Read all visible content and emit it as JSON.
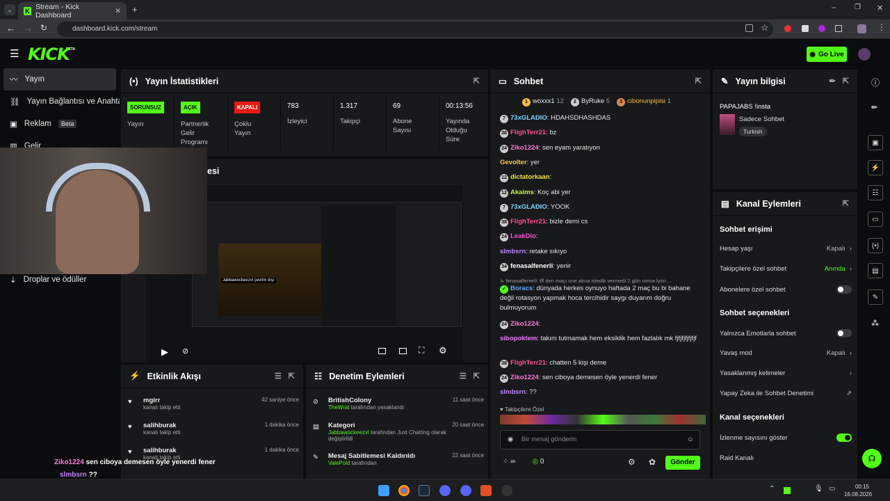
{
  "browser": {
    "tab_title": "Stream - Kick Dashboard",
    "url": "dashboard.kick.com/stream"
  },
  "header": {
    "logo": "KICK",
    "beta": "BETA",
    "go_live": "Go Live"
  },
  "sidebar": {
    "items": [
      {
        "label": "Yayın"
      },
      {
        "label": "Yayın Bağlantısı ve Anahtar"
      },
      {
        "label": "Reklam",
        "badge": "Beta"
      },
      {
        "label": "Gelir"
      },
      {
        "label": "Droplar ve ödüller"
      }
    ]
  },
  "stats": {
    "title": "Yayın İstatistikleri",
    "cells": [
      {
        "badge": "SORUNSUZ",
        "label": "Yayın"
      },
      {
        "badge": "AÇIK",
        "label": "Partnerlik Gelir Programı"
      },
      {
        "badge": "KAPALI",
        "label": "Çoklu Yayın"
      },
      {
        "value": "783",
        "label": "İzleyici"
      },
      {
        "value": "1.317",
        "label": "Takipçi"
      },
      {
        "value": "69",
        "label": "Abone Sayısı"
      },
      {
        "value": "00:13:56",
        "label": "Yayında Olduğu Süre"
      }
    ]
  },
  "preview": {
    "title_fragment": "esi",
    "stream_text": "Jabbawockeezvl çevrim dışı"
  },
  "activity": {
    "title": "Etkinlik Akışı",
    "items": [
      {
        "user": "mgirr",
        "sub": "kanalı takip etti",
        "time": "42 saniye önce"
      },
      {
        "user": "salihburak",
        "sub": "kanalı takip etti",
        "time": "1 dakika önce"
      },
      {
        "user": "salihburak",
        "sub": "kanalı takip etti",
        "time": "1 dakika önce"
      }
    ]
  },
  "moderation": {
    "title": "Denetim Eylemleri",
    "items": [
      {
        "title": "BritishColony",
        "actor": "TheWrat",
        "sub": "tarafından yasaklandı",
        "time": "11 saat önce"
      },
      {
        "title": "Kategori",
        "actor": "Jabbawockeezvl",
        "sub": "tarafından Just Chatting olarak değiştirildi",
        "time": "20 saat önce"
      },
      {
        "title": "Mesaj Sabitlemesi Kaldırıldı",
        "actor": "ValePold",
        "sub": "tarafından",
        "time": "22 saat önce"
      }
    ]
  },
  "chat": {
    "title": "Sohbet",
    "top": [
      {
        "name": "woxxx1",
        "n": "12"
      },
      {
        "name": "ByRuke",
        "n": "5"
      },
      {
        "name": "cibonunpipisi",
        "n": "1"
      }
    ],
    "messages": [
      {
        "lvl": "7",
        "user": "73xGLADIO",
        "color": "#7dd3fc",
        "text": "HDAHSDHASHDAS"
      },
      {
        "lvl": "38",
        "user": "FlighTerr21",
        "color": "#ff4f8b",
        "text": "bz"
      },
      {
        "lvl": "24",
        "user": "Ziko1224",
        "color": "#ff7ad9",
        "text": "sen eyam yaratıyon"
      },
      {
        "lvl": "",
        "user": "Gevolter",
        "color": "#f5c842",
        "text": "yer"
      },
      {
        "lvl": "12",
        "user": "dictatorkaan",
        "color": "#f5e042",
        "text": ""
      },
      {
        "lvl": "12",
        "user": "Akaims",
        "color": "#c6f542",
        "text": "Koç abi yer"
      },
      {
        "lvl": "7",
        "user": "73xGLADIO",
        "color": "#7dd3fc",
        "text": "YOOK"
      },
      {
        "lvl": "38",
        "user": "FlighTerr21",
        "color": "#ff4f8b",
        "text": "bizle demi cs"
      },
      {
        "lvl": "24",
        "user": "LeakDio",
        "color": "#ff4fd8",
        "text": ""
      },
      {
        "lvl": "",
        "user": "slmbsrn",
        "color": "#c084fc",
        "text": "retake sıkıyo"
      },
      {
        "lvl": "34",
        "user": "fenasalfenerli",
        "color": "#ffffff",
        "text": "yenir"
      }
    ],
    "reply": "fenasalfenerli: tff den maçı one alma istedik vermedi 2 gün sonra lyon ...",
    "boracs": {
      "user": "Boracs",
      "text": "dünyada herkes oynuyo haftada 2 maç bu bi bahane değil rotasyon yapmak hoca tercihidir saygı duyarım doğru bulmuyorum"
    },
    "messages2": [
      {
        "lvl": "24",
        "user": "Ziko1224",
        "color": "#ff7ad9",
        "text": ""
      },
      {
        "lvl": "",
        "user": "sibopoktem",
        "color": "#e879f9",
        "text": "takım tutmamak hem eksiklik hem fazlalık mk fjfjfjfjfjfjf"
      },
      {
        "lvl": "38",
        "user": "FlighTerr21",
        "color": "#ff4f8b",
        "text": "chatten 5 kişi deme"
      },
      {
        "lvl": "24",
        "user": "Ziko1224",
        "color": "#ff7ad9",
        "text": "sen ciboya demesen öyle yenerdi fener"
      },
      {
        "lvl": "",
        "user": "slmbsrn",
        "color": "#c084fc",
        "text": "??"
      }
    ],
    "followers_only": "Takipçilere Özel",
    "input_placeholder": "Bir mesaj gönderin",
    "infinity": "∞",
    "points": "0",
    "send": "Gönder"
  },
  "overlay": [
    {
      "user": "Ziko1224",
      "text": "sen ciboya demesen öyle yenerdi fener"
    },
    {
      "user": "slmbsrn",
      "text": "??"
    }
  ],
  "stream_info": {
    "title": "Yayın bilgisi",
    "stream_title": "PAPAJABS !insta",
    "category": "Sadece Sohbet",
    "tag": "Turkish"
  },
  "channel": {
    "title": "Kanal Eylemleri",
    "chat_access": "Sohbet erişimi",
    "account_age": {
      "label": "Hesap yaşı",
      "value": "Kapalı"
    },
    "followers_chat": {
      "label": "Takipçilere özel sohbet",
      "value": "Anında"
    },
    "subs_chat": {
      "label": "Abonelere özel sohbet"
    },
    "chat_options": "Sohbet seçenekleri",
    "emote_only": {
      "label": "Yalnızca Emotlarla sohbet"
    },
    "slow": {
      "label": "Yavaş mod",
      "value": "Kapalı"
    },
    "banned_words": {
      "label": "Yasaklanmış kelimeler"
    },
    "ai_mod": {
      "label": "Yapay Zeka ile Sohbet Denetimi"
    },
    "channel_options": "Kanal seçenekleri",
    "viewer_count": {
      "label": "İzlenme sayısını göster"
    },
    "raid": {
      "label": "Raid Kanalı"
    }
  },
  "taskbar": {
    "time": "00:15",
    "date": "16.08.2026"
  },
  "colors": {
    "accent": "#53fc18",
    "panel": "#18191b",
    "bg": "#0b0c0d"
  }
}
